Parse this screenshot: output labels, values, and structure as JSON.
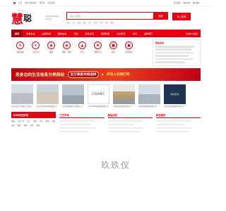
{
  "topbar": {
    "left": [
      "首页",
      "您好,欢迎来到",
      "请登录",
      "免费注册"
    ],
    "right": [
      "会员服务",
      "网站导航",
      "联系我们"
    ]
  },
  "header": {
    "logo_mark": "慧",
    "logo_text": "聪",
    "logo_en": "HUICONG",
    "slogan": "中国领先的B2B电子商务平台",
    "search_placeholder": "请输入关键词",
    "search_button": "搜索",
    "free_button": "马上发布",
    "hotwords": [
      "机械",
      "五金",
      "服装",
      "家纺",
      "化工",
      "照明",
      "灯具",
      "安防",
      "家居"
    ]
  },
  "nav": {
    "items": [
      "首页",
      "供求信息",
      "品牌商城",
      "展会信息",
      "行情",
      "商务资讯",
      "招商加盟",
      "企业黄页",
      "资讯",
      "品牌展厅"
    ],
    "vip": "商城Vip会员"
  },
  "categories": [
    {
      "label": "机械设备",
      "icon": "gear-icon",
      "glyph": "⚙"
    },
    {
      "label": "五金工具",
      "icon": "wrench-icon",
      "glyph": "✦"
    },
    {
      "label": "服装",
      "icon": "shirt-icon",
      "glyph": "◆"
    },
    {
      "label": "服饰、配饰",
      "icon": "bag-icon",
      "glyph": "◉"
    },
    {
      "label": "化工",
      "icon": "flask-icon",
      "glyph": "▲"
    },
    {
      "label": "照明灯具",
      "icon": "lamp-icon",
      "glyph": "✺"
    },
    {
      "label": "家居",
      "icon": "home-icon",
      "glyph": "■"
    },
    {
      "label": "商务服务",
      "icon": "briefcase-icon",
      "glyph": "●"
    }
  ],
  "news": {
    "title": "网站动态"
  },
  "banner": {
    "part1": "您身边的生活信息分类网站",
    "part2": "百万商家共同选择",
    "part3": "赶快入驻我们吧"
  },
  "photos": [
    {
      "caption": "苏州市某某工业园区厂房出租",
      "style": "a"
    },
    {
      "caption": "昆山市某某物流仓储有限公司",
      "style": "b"
    },
    {
      "caption": "江苏某某钢结构工程有限公司",
      "style": "c"
    },
    {
      "caption": "上海CRANC起重机械有限公司",
      "style": "d",
      "text": "CRANC"
    },
    {
      "caption": "宁波某某装饰材料有限公司",
      "style": "e"
    },
    {
      "caption": "无锡某某机械制造有限公司",
      "style": "f"
    },
    {
      "caption": "江阴市某某精密模具有限公司",
      "style": "g",
      "text": "精密模具"
    }
  ],
  "columns": [
    {
      "title": "B2B行业市场",
      "links": [
        "机械",
        "五金工具",
        "化工",
        "服装",
        "电子",
        "照明",
        "纺织",
        "安防",
        "家居",
        "建材",
        "包装",
        "印刷"
      ]
    },
    {
      "title": "工艺市场"
    },
    {
      "title": "展会动态"
    },
    {
      "title": "商务服务"
    }
  ],
  "watermark": "玖玖仪"
}
